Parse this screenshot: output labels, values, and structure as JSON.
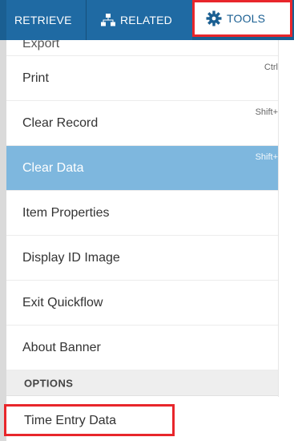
{
  "toolbar": {
    "retrieve_label": "RETRIEVE",
    "related_label": "RELATED",
    "tools_label": "TOOLS"
  },
  "menu": {
    "partial_item": "Export",
    "items": [
      {
        "label": "Print",
        "shortcut": "Ctrl"
      },
      {
        "label": "Clear Record",
        "shortcut": "Shift+"
      },
      {
        "label": "Clear Data",
        "shortcut": "Shift+"
      },
      {
        "label": "Item Properties",
        "shortcut": ""
      },
      {
        "label": "Display ID Image",
        "shortcut": ""
      },
      {
        "label": "Exit Quickflow",
        "shortcut": ""
      },
      {
        "label": "About Banner",
        "shortcut": ""
      }
    ],
    "selected_item": "Clear Data"
  },
  "options_section": {
    "header": "OPTIONS",
    "items": [
      {
        "label": "Time Entry Data"
      }
    ]
  },
  "icons": {
    "related": "sitemap-icon",
    "tools": "gear-icon"
  },
  "colors": {
    "toolbar_bg": "#1a5f92",
    "selected_bg": "#7eb7de",
    "highlight": "#e8262b"
  }
}
